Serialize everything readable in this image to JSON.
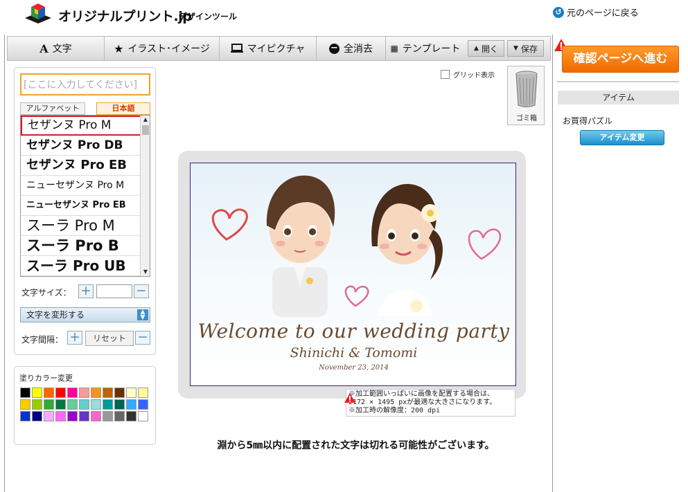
{
  "header": {
    "brand": "オリジナルプリント.jp",
    "subtitle": "デザインツール",
    "back_link": "元のページに戻る"
  },
  "toolbar": {
    "text": "文字",
    "illust": "イラスト･イメージ",
    "my_picture": "マイピクチャ",
    "clear_all": "全消去",
    "template": "テンプレート",
    "open": "開く",
    "save": "保存"
  },
  "text_panel": {
    "input_placeholder": "[ここに入力してください]",
    "tab_alphabet": "アルファベット",
    "tab_japanese": "日本語",
    "fonts": [
      "セザンヌ Pro M",
      "セザンヌ Pro DB",
      "セザンヌ Pro EB",
      "ニューセザンヌ Pro M",
      "ニューセザンヌ Pro EB",
      "スーラ Pro M",
      "スーラ Pro B",
      "スーラ Pro UB"
    ],
    "selected_font": "セザンヌ Pro M",
    "size_label": "文字サイズ：",
    "plus": "＋",
    "minus": "－",
    "transform_label": "文字を変形する",
    "spacing_label": "文字間隔：",
    "reset_label": "リセット"
  },
  "color_panel": {
    "title": "塗りカラー変更",
    "swatches": [
      "#000000",
      "#ffff00",
      "#ff6600",
      "#ff0000",
      "#ff0099",
      "#ff9999",
      "#f7941d",
      "#c06010",
      "#663300",
      "#ffffcc",
      "#ffff99",
      "#ffcc00",
      "#99cc00",
      "#33aa33",
      "#007744",
      "#66cc99",
      "#66cccc",
      "#99dddd",
      "#009999",
      "#006655",
      "#33aaff",
      "#3366ff",
      "#0033cc",
      "#000080",
      "#ffaaff",
      "#ff66ff",
      "#9900cc",
      "#6633cc",
      "#ff66cc",
      "#999999",
      "#666666",
      "#333333",
      "#ffffff"
    ]
  },
  "canvas": {
    "grid_label": "グリッド表示",
    "trash_label": "ゴミ箱",
    "welcome": "Welcome to our wedding party",
    "names": "Shinichi & Tomomi",
    "date": "November 23, 2014",
    "note_line1": "※加工範囲いっぱいに画像を配置する場合は、",
    "note_line2": "2172 × 1495 pxが最適な大きさになります。",
    "note_line3": "※加工時の解像度：200 dpi",
    "bottom_message": "淵から5㎜以内に配置された文字は切れる可能性がございます。"
  },
  "right_panel": {
    "confirm_button": "確認ページへ進む",
    "item_header": "アイテム",
    "item_name": "お買得パズル",
    "item_change": "アイテム変更"
  }
}
